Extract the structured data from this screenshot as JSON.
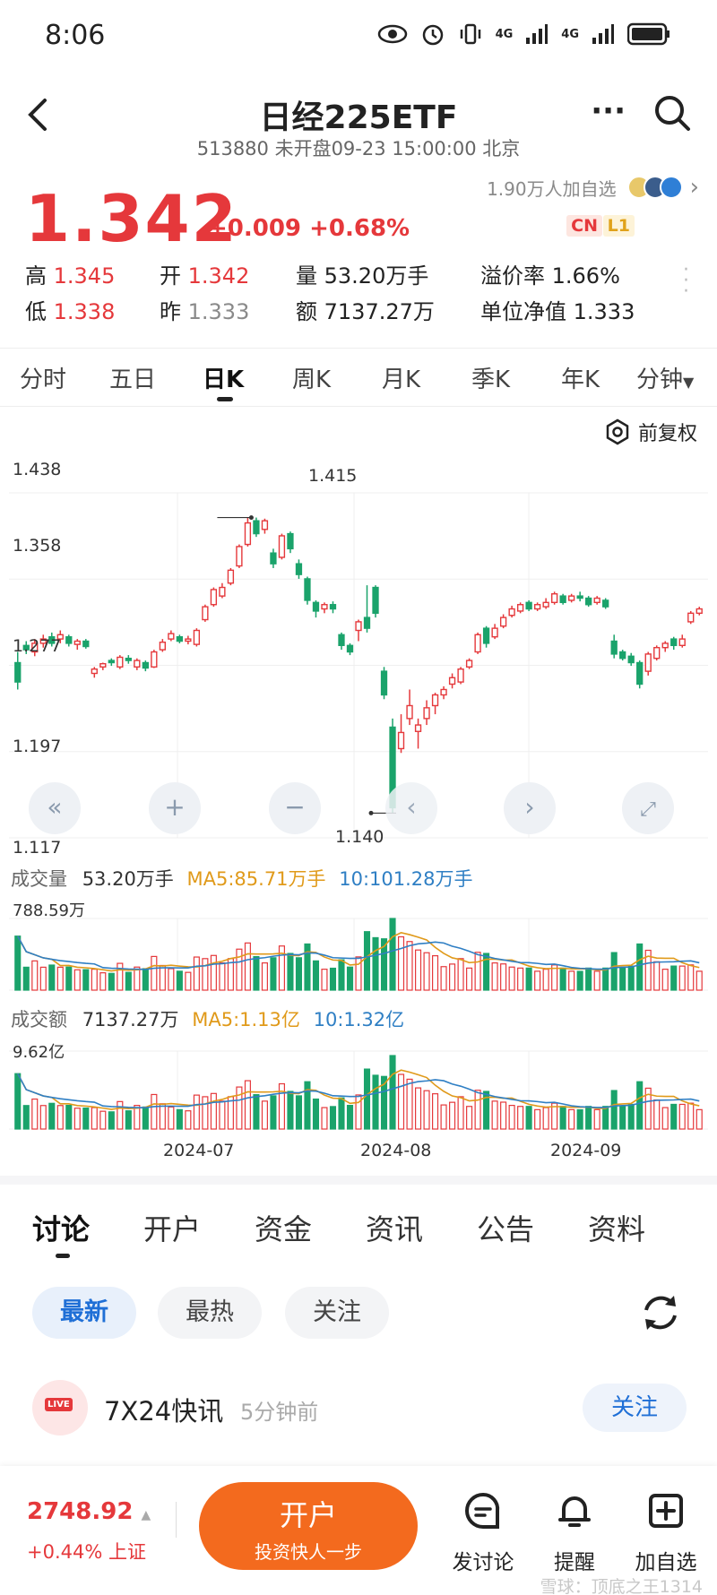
{
  "status_bar": {
    "time": "8:06",
    "signal_1": "4G",
    "signal_2": "4G"
  },
  "header": {
    "title": "日经225ETF",
    "subtitle": "513880 未开盘09-23 15:00:00 北京"
  },
  "quote": {
    "price": "1.342",
    "change": "+0.009",
    "change_pct": "+0.68%",
    "followers": "1.90万人加自选",
    "tag_cn": "CN",
    "tag_l1": "L1",
    "stats": {
      "high_label": "高",
      "high": "1.345",
      "open_label": "开",
      "open": "1.342",
      "vol_label": "量",
      "vol": "53.20万手",
      "premium_label": "溢价率",
      "premium": "1.66%",
      "low_label": "低",
      "low": "1.338",
      "prev_label": "昨",
      "prev": "1.333",
      "amt_label": "额",
      "amt": "7137.27万",
      "nav_label": "单位净值",
      "nav": "1.333"
    }
  },
  "period_tabs": [
    "分时",
    "五日",
    "日K",
    "周K",
    "月K",
    "季K",
    "年K",
    "分钟"
  ],
  "active_period": "日K",
  "adjust_label": "前复权",
  "chart_data": {
    "type": "candlestick",
    "y_ticks": [
      "1.438",
      "1.358",
      "1.277",
      "1.197",
      "1.117"
    ],
    "ylim": [
      1.117,
      1.438
    ],
    "max_label": "1.415",
    "min_label": "1.140",
    "x_ticks": [
      "2024-07",
      "2024-08",
      "2024-09"
    ],
    "candles": [
      [
        1.28,
        1.262,
        1.29,
        1.255
      ],
      [
        1.296,
        1.292,
        1.3,
        1.288
      ],
      [
        1.29,
        1.298,
        1.302,
        1.286
      ],
      [
        1.298,
        1.302,
        1.306,
        1.294
      ],
      [
        1.304,
        1.298,
        1.308,
        1.295
      ],
      [
        1.302,
        1.306,
        1.31,
        1.298
      ],
      [
        1.304,
        1.298,
        1.306,
        1.295
      ],
      [
        1.297,
        1.3,
        1.302,
        1.292
      ],
      [
        1.3,
        1.295,
        1.302,
        1.293
      ],
      [
        1.27,
        1.274,
        1.276,
        1.266
      ],
      [
        1.276,
        1.279,
        1.28,
        1.273
      ],
      [
        1.282,
        1.28,
        1.284,
        1.277
      ],
      [
        1.276,
        1.285,
        1.287,
        1.274
      ],
      [
        1.284,
        1.282,
        1.287,
        1.279
      ],
      [
        1.276,
        1.282,
        1.284,
        1.273
      ],
      [
        1.28,
        1.275,
        1.282,
        1.272
      ],
      [
        1.276,
        1.29,
        1.292,
        1.275
      ],
      [
        1.292,
        1.299,
        1.302,
        1.29
      ],
      [
        1.302,
        1.307,
        1.31,
        1.3
      ],
      [
        1.304,
        1.3,
        1.306,
        1.298
      ],
      [
        1.3,
        1.302,
        1.305,
        1.297
      ],
      [
        1.297,
        1.31,
        1.312,
        1.295
      ],
      [
        1.32,
        1.332,
        1.334,
        1.318
      ],
      [
        1.334,
        1.348,
        1.35,
        1.332
      ],
      [
        1.342,
        1.35,
        1.354,
        1.34
      ],
      [
        1.354,
        1.366,
        1.368,
        1.352
      ],
      [
        1.37,
        1.388,
        1.39,
        1.368
      ],
      [
        1.39,
        1.41,
        1.415,
        1.388
      ],
      [
        1.412,
        1.4,
        1.415,
        1.397
      ],
      [
        1.404,
        1.412,
        1.414,
        1.4
      ],
      [
        1.382,
        1.372,
        1.386,
        1.368
      ],
      [
        1.378,
        1.398,
        1.4,
        1.376
      ],
      [
        1.4,
        1.386,
        1.402,
        1.382
      ],
      [
        1.372,
        1.362,
        1.376,
        1.358
      ],
      [
        1.358,
        1.338,
        1.36,
        1.334
      ],
      [
        1.336,
        1.328,
        1.338,
        1.322
      ],
      [
        1.33,
        1.334,
        1.336,
        1.326
      ],
      [
        1.334,
        1.33,
        1.337,
        1.326
      ],
      [
        1.306,
        1.296,
        1.308,
        1.292
      ],
      [
        1.296,
        1.29,
        1.298,
        1.287
      ],
      [
        1.31,
        1.318,
        1.32,
        1.3
      ],
      [
        1.322,
        1.312,
        1.352,
        1.308
      ],
      [
        1.35,
        1.326,
        1.352,
        1.322
      ],
      [
        1.272,
        1.25,
        1.276,
        1.246
      ],
      [
        1.22,
        1.145,
        1.228,
        1.14
      ],
      [
        1.2,
        1.215,
        1.232,
        1.196
      ],
      [
        1.228,
        1.24,
        1.255,
        1.222
      ],
      [
        1.216,
        1.222,
        1.228,
        1.2
      ],
      [
        1.228,
        1.238,
        1.245,
        1.222
      ],
      [
        1.24,
        1.25,
        1.252,
        1.232
      ],
      [
        1.25,
        1.255,
        1.258,
        1.246
      ],
      [
        1.26,
        1.266,
        1.27,
        1.256
      ],
      [
        1.262,
        1.274,
        1.276,
        1.26
      ],
      [
        1.276,
        1.282,
        1.284,
        1.274
      ],
      [
        1.29,
        1.306,
        1.308,
        1.288
      ],
      [
        1.312,
        1.298,
        1.314,
        1.294
      ],
      [
        1.304,
        1.312,
        1.316,
        1.302
      ],
      [
        1.314,
        1.322,
        1.325,
        1.312
      ],
      [
        1.324,
        1.33,
        1.333,
        1.322
      ],
      [
        1.328,
        1.334,
        1.336,
        1.326
      ],
      [
        1.336,
        1.33,
        1.338,
        1.328
      ],
      [
        1.33,
        1.334,
        1.336,
        1.328
      ],
      [
        1.332,
        1.336,
        1.34,
        1.33
      ],
      [
        1.336,
        1.344,
        1.346,
        1.334
      ],
      [
        1.342,
        1.336,
        1.344,
        1.334
      ],
      [
        1.338,
        1.342,
        1.344,
        1.336
      ],
      [
        1.342,
        1.34,
        1.346,
        1.337
      ],
      [
        1.34,
        1.334,
        1.342,
        1.332
      ],
      [
        1.336,
        1.34,
        1.342,
        1.334
      ],
      [
        1.338,
        1.332,
        1.34,
        1.33
      ],
      [
        1.3,
        1.288,
        1.306,
        1.284
      ],
      [
        1.29,
        1.284,
        1.292,
        1.282
      ],
      [
        1.286,
        1.28,
        1.289,
        1.277
      ],
      [
        1.28,
        1.26,
        1.282,
        1.256
      ],
      [
        1.272,
        1.288,
        1.29,
        1.268
      ],
      [
        1.284,
        1.294,
        1.296,
        1.282
      ],
      [
        1.294,
        1.298,
        1.3,
        1.29
      ],
      [
        1.302,
        1.296,
        1.304,
        1.292
      ],
      [
        1.296,
        1.302,
        1.306,
        1.294
      ],
      [
        1.318,
        1.326,
        1.328,
        1.316
      ],
      [
        1.326,
        1.33,
        1.332,
        1.324
      ]
    ],
    "volume": {
      "label": "成交量",
      "value": "53.20万手",
      "ma5": "MA5:85.71万手",
      "ma10": "10:101.28万手",
      "max": "788.59万"
    },
    "amount": {
      "label": "成交额",
      "value": "7137.27万",
      "ma5": "MA5:1.13亿",
      "ma10": "10:1.32亿",
      "max": "9.62亿"
    }
  },
  "discussion_tabs": [
    "讨论",
    "开户",
    "资金",
    "资讯",
    "公告",
    "资料"
  ],
  "filters": [
    "最新",
    "最热",
    "关注"
  ],
  "news": {
    "source": "7X24快讯",
    "time": "5分钟前",
    "follow": "关注",
    "live": "LIVE"
  },
  "bottom": {
    "index_value": "2748.92",
    "index_change": "+0.44% 上证",
    "open_title": "开户",
    "open_sub": "投资快人一步",
    "post": "发讨论",
    "alert": "提醒",
    "watch": "加自选",
    "watermark": "雪球：顶底之王1314"
  },
  "colors": {
    "up": "#e5383b",
    "down": "#1aa36b",
    "accent": "#f36a1e",
    "link": "#1f6fd6"
  }
}
